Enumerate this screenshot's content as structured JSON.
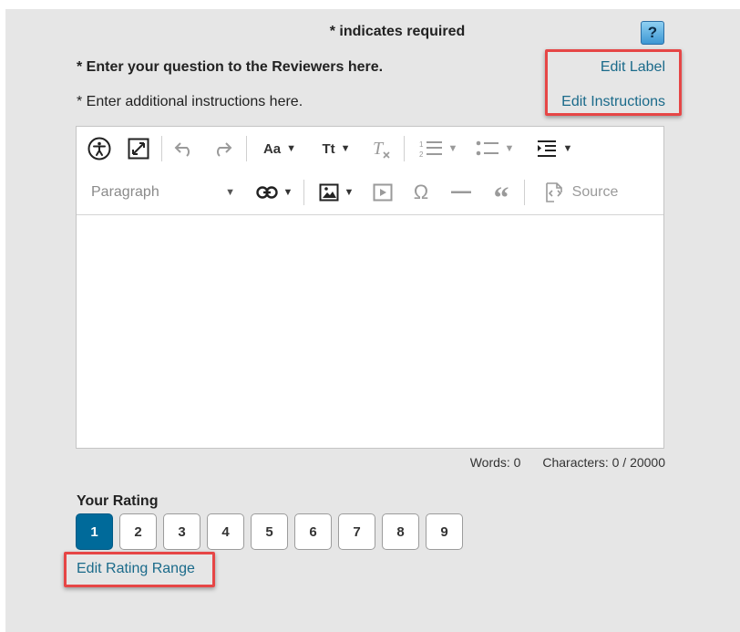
{
  "header": {
    "required_note": "* indicates required",
    "help_label": "?"
  },
  "question": {
    "label": "* Enter your question to the Reviewers here.",
    "instructions": "* Enter additional instructions here.",
    "edit_label_link": "Edit Label",
    "edit_instructions_link": "Edit Instructions"
  },
  "editor": {
    "paragraph_style": "Paragraph",
    "source_label": "Source",
    "font_family_glyph": "Aa",
    "font_size_glyph": "Tt",
    "toolbar_icons": [
      "accessibility-icon",
      "fullscreen-icon",
      "undo-icon",
      "redo-icon",
      "font-family-icon",
      "font-size-icon",
      "remove-format-icon",
      "numbered-list-icon",
      "bulleted-list-icon",
      "indent-icon",
      "link-icon",
      "image-icon",
      "media-icon",
      "special-characters-icon",
      "horizontal-line-icon",
      "blockquote-icon",
      "source-icon"
    ]
  },
  "counts": {
    "words": "Words: 0",
    "characters": "Characters: 0 / 20000"
  },
  "rating": {
    "label": "Your Rating",
    "options": [
      "1",
      "2",
      "3",
      "4",
      "5",
      "6",
      "7",
      "8",
      "9"
    ],
    "selected": "1",
    "edit_range_link": "Edit Rating Range"
  },
  "colors": {
    "panel_bg": "#e6e6e6",
    "link": "#1a6a8a",
    "selected_rating": "#006a9a",
    "highlight_box": "#e64646"
  }
}
